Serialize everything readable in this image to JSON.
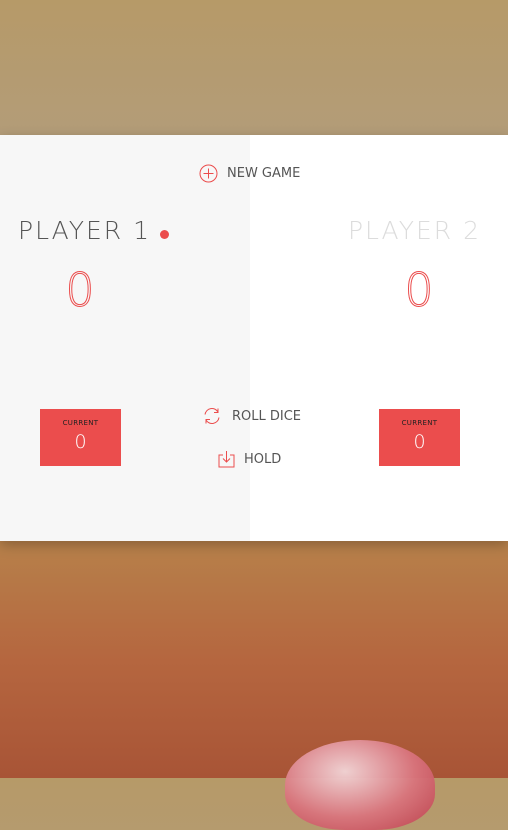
{
  "controls": {
    "new_game_label": "NEW GAME",
    "roll_dice_label": "ROLL DICE",
    "hold_label": "HOLD"
  },
  "players": [
    {
      "name": "PLAYER 1",
      "score": "0",
      "current_label": "CURRENT",
      "current_value": "0",
      "active": true
    },
    {
      "name": "PLAYER 2",
      "score": "0",
      "current_label": "CURRENT",
      "current_value": "0",
      "active": false
    }
  ],
  "colors": {
    "accent": "#eb4d4d",
    "active_panel": "#f7f7f7",
    "inactive_panel": "#ffffff",
    "active_text": "#555555",
    "inactive_text": "#dcdcdc"
  },
  "icons": {
    "new_game": "plus-circle-icon",
    "roll_dice": "refresh-icon",
    "hold": "download-icon",
    "active_player": "active-dot-icon"
  }
}
